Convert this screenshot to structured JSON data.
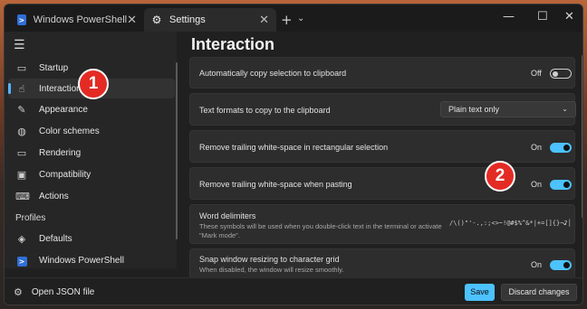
{
  "tabs": [
    {
      "label": "Windows PowerShell",
      "icon": "powershell-icon"
    },
    {
      "label": "Settings",
      "icon": "gear-icon"
    }
  ],
  "window_controls": {
    "minimize": "—",
    "maximize": "☐",
    "close": "✕"
  },
  "nav": {
    "items": [
      {
        "label": "Startup",
        "icon": "startup-icon"
      },
      {
        "label": "Interaction",
        "icon": "interaction-icon",
        "active": true
      },
      {
        "label": "Appearance",
        "icon": "brush-icon"
      },
      {
        "label": "Color schemes",
        "icon": "palette-icon"
      },
      {
        "label": "Rendering",
        "icon": "monitor-icon"
      },
      {
        "label": "Compatibility",
        "icon": "compatibility-icon"
      },
      {
        "label": "Actions",
        "icon": "keyboard-icon"
      }
    ],
    "profiles_header": "Profiles",
    "profiles": [
      {
        "label": "Defaults",
        "icon": "layers-icon"
      },
      {
        "label": "Windows PowerShell",
        "icon": "powershell-icon"
      }
    ]
  },
  "page_title": "Interaction",
  "settings": [
    {
      "label": "Automatically copy selection to clipboard",
      "state": "Off"
    },
    {
      "label": "Text formats to copy to the clipboard",
      "value": "Plain text only"
    },
    {
      "label": "Remove trailing white-space in rectangular selection",
      "state": "On"
    },
    {
      "label": "Remove trailing white-space when pasting",
      "state": "On"
    },
    {
      "label": "Word delimiters",
      "description": "These symbols will be used when you double-click text in the terminal or activate \"Mark mode\".",
      "value": "/\\()\"'-.,:;<>~!@#$%^&*|+=[]{}~?│"
    },
    {
      "label": "Snap window resizing to character grid",
      "description": "When disabled, the window will resize smoothly.",
      "state": "On"
    }
  ],
  "footer": {
    "open_json": "Open JSON file",
    "save": "Save",
    "discard": "Discard changes"
  },
  "annotations": [
    "1",
    "2"
  ],
  "colors": {
    "accent": "#4cc2ff",
    "annotation": "#e32b24"
  }
}
